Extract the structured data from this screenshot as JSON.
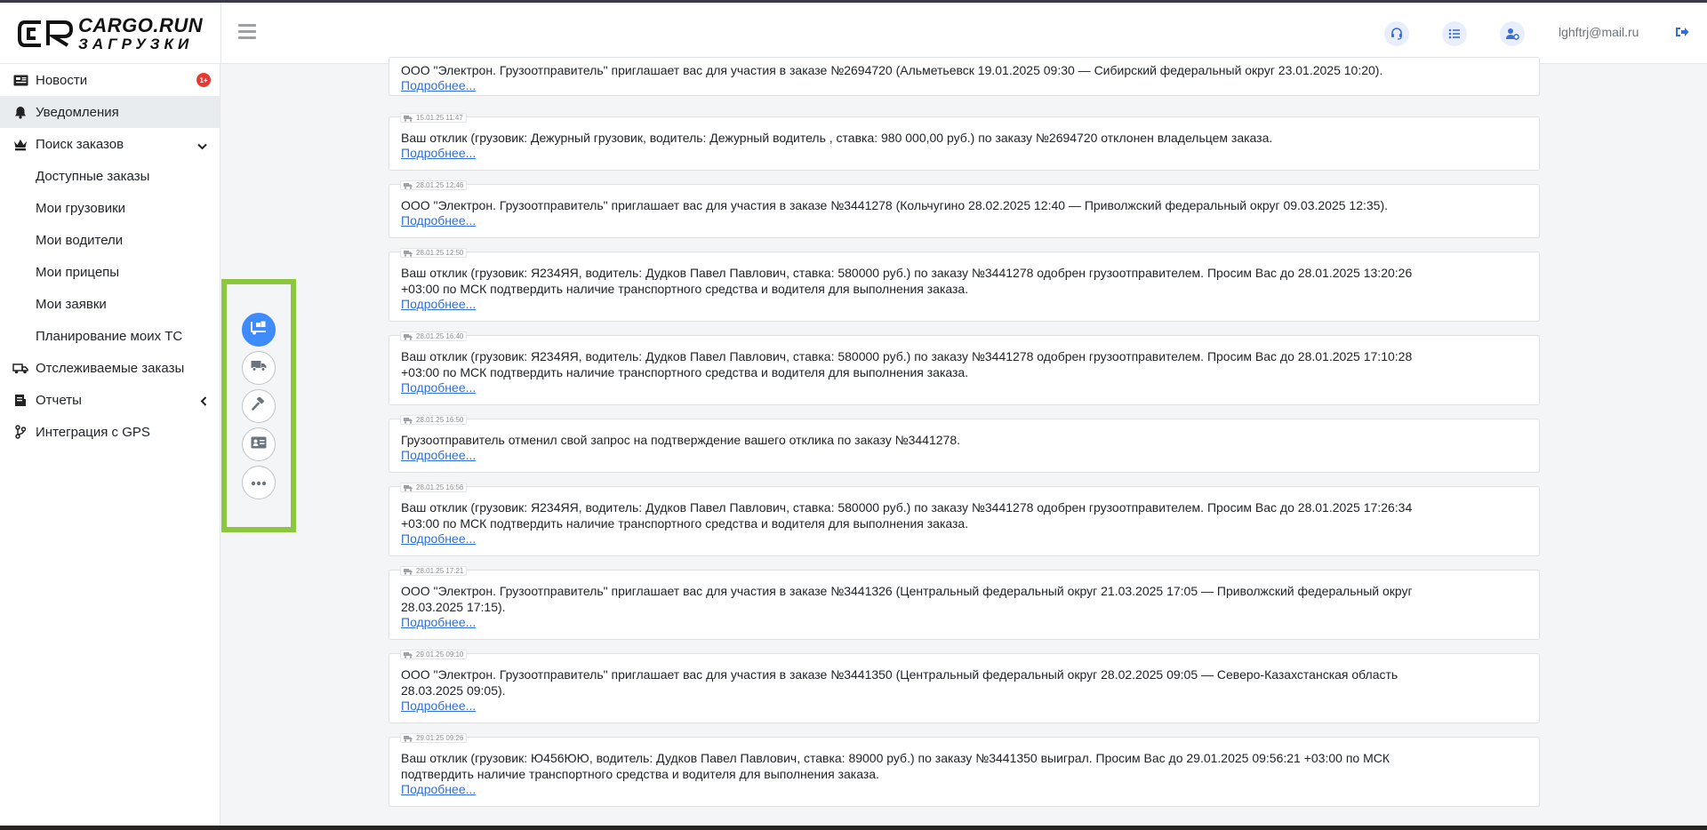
{
  "app": {
    "logo_line1": "CARGO.RUN",
    "logo_line2": "ЗАГРУЗКИ",
    "user_email": "lghftrj@mail.ru",
    "accent_color": "#3d8bfd",
    "highlight_color": "#8dc63f"
  },
  "sidebar": {
    "items": [
      {
        "label": "Новости",
        "icon": "newspaper-icon",
        "badge": "1+"
      },
      {
        "label": "Уведомления",
        "icon": "bell-icon",
        "active": true
      },
      {
        "label": "Поиск заказов",
        "icon": "chess-king-icon",
        "expanded": true
      },
      {
        "label": "Отслеживаемые заказы",
        "icon": "truck-icon"
      },
      {
        "label": "Отчеты",
        "icon": "report-icon"
      },
      {
        "label": "Интеграция с GPS",
        "icon": "git-branch-icon"
      }
    ],
    "sub_items": [
      {
        "label": "Доступные заказы"
      },
      {
        "label": "Мои грузовики"
      },
      {
        "label": "Мои водители"
      },
      {
        "label": "Мои прицепы"
      },
      {
        "label": "Мои заявки"
      },
      {
        "label": "Планирование моих ТС"
      }
    ]
  },
  "fab_panel": {
    "buttons": [
      {
        "icon": "truck-loading-icon",
        "active": true
      },
      {
        "icon": "truck-icon"
      },
      {
        "icon": "gavel-icon"
      },
      {
        "icon": "id-card-icon"
      },
      {
        "icon": "more-dots-icon"
      }
    ]
  },
  "feed": {
    "more_label": "Подробнее...",
    "notifications": [
      {
        "time": "",
        "lines": [
          "ООО \"Электрон. Грузоотправитель\" приглашает вас для участия в заказе №2694720 (Альметьевск 19.01.2025 09:30 — Сибирский федеральный округ 23.01.2025 10:20)."
        ]
      },
      {
        "time": "15.01.25 11:47",
        "lines": [
          "Ваш отклик (грузовик: Дежурный грузовик, водитель: Дежурный водитель  , ставка: 980 000,00 руб.) по заказу №2694720 отклонен владельцем заказа."
        ]
      },
      {
        "time": "28.01.25 12:46",
        "lines": [
          "ООО \"Электрон. Грузоотправитель\" приглашает вас для участия в заказе №3441278 (Кольчугино 28.02.2025 12:40 — Приволжский федеральный округ 09.03.2025 12:35)."
        ]
      },
      {
        "time": "28.01.25 12:50",
        "lines": [
          "Ваш отклик (грузовик: Я234ЯЯ, водитель: Дудков Павел Павлович, ставка: 580000 руб.) по заказу №3441278 одобрен грузоотправителем. Просим Вас до 28.01.2025 13:20:26",
          "+03:00 по МСК подтвердить наличие транспортного средства и водителя для выполнения заказа."
        ]
      },
      {
        "time": "28.01.25 16:40",
        "lines": [
          "Ваш отклик (грузовик: Я234ЯЯ, водитель: Дудков Павел Павлович, ставка: 580000 руб.) по заказу №3441278 одобрен грузоотправителем. Просим Вас до 28.01.2025 17:10:28",
          "+03:00 по МСК подтвердить наличие транспортного средства и водителя для выполнения заказа."
        ]
      },
      {
        "time": "28.01.25 16:50",
        "lines": [
          "Грузоотправитель отменил свой запрос на подтверждение вашего отклика по заказу №3441278."
        ]
      },
      {
        "time": "28.01.25 16:56",
        "lines": [
          "Ваш отклик (грузовик: Я234ЯЯ, водитель: Дудков Павел Павлович, ставка: 580000 руб.) по заказу №3441278 одобрен грузоотправителем. Просим Вас до 28.01.2025 17:26:34",
          "+03:00 по МСК подтвердить наличие транспортного средства и водителя для выполнения заказа."
        ]
      },
      {
        "time": "28.01.25 17:21",
        "lines": [
          "ООО \"Электрон. Грузоотправитель\" приглашает вас для участия в заказе №3441326 (Центральный федеральный округ 21.03.2025 17:05 — Приволжский федеральный округ",
          "28.03.2025 17:15)."
        ]
      },
      {
        "time": "29.01.25 09:10",
        "lines": [
          "ООО \"Электрон. Грузоотправитель\" приглашает вас для участия в заказе №3441350 (Центральный федеральный округ 28.02.2025 09:05 — Северо-Казахстанская область",
          "28.03.2025 09:05)."
        ]
      },
      {
        "time": "29.01.25 09:26",
        "lines": [
          "Ваш отклик (грузовик: Ю456ЮЮ, водитель: Дудков Павел Павлович, ставка: 89000 руб.) по заказу №3441350 выиграл. Просим Вас до 29.01.2025 09:56:21 +03:00 по МСК",
          "подтвердить наличие транспортного средства и водителя для выполнения заказа."
        ]
      }
    ]
  }
}
